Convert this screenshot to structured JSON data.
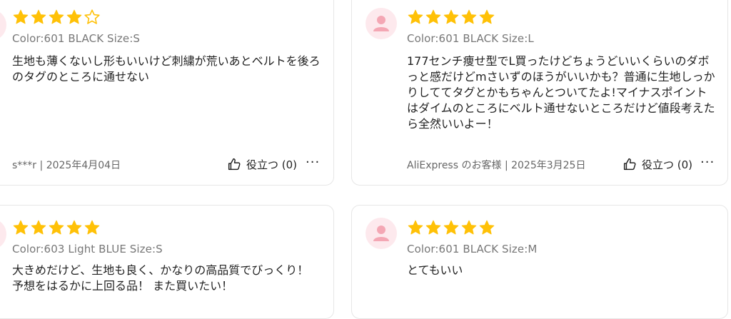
{
  "reviews": [
    {
      "rating": 4,
      "variant": "Color:601 BLACK Size:S",
      "text": "生地も薄くないし形もいいけど刺繍が荒いあとベルトを後ろのタグのところに通せない",
      "reviewer": "s***r",
      "separator": "|",
      "date": "2025年4月04日",
      "helpful_label": "役立つ (0)",
      "more_label": "···"
    },
    {
      "rating": 5,
      "variant": "Color:601 BLACK Size:L",
      "text": "177センチ痩せ型でL買ったけどちょうどいいくらいのダボっと感だけどmさいずのほうがいいかも？普通に生地しっかりしててタグとかもちゃんとついてたよ!マイナスポイントはダイムのところにベルト通せないところだけど値段考えたら全然いいよー！",
      "reviewer": "AliExpress のお客様",
      "separator": "|",
      "date": "2025年3月25日",
      "helpful_label": "役立つ (0)",
      "more_label": "···"
    },
    {
      "rating": 5,
      "variant": "Color:603 Light BLUE Size:S",
      "text": "大きめだけど、生地も良く、かなりの高品質でびっくり！ 予想をはるかに上回る品！ また買いたい！"
    },
    {
      "rating": 5,
      "variant": "Color:601 BLACK Size:M",
      "text": "とてもいい"
    }
  ],
  "colors": {
    "star_filled": "#FFC107",
    "star_empty_outline": "#FFC107",
    "avatar_bg": "#FDE9ED",
    "avatar_icon": "#F4A7B4",
    "card_border": "#E6E6E6"
  },
  "icons": {
    "avatar": "user-silhouette-icon",
    "helpful": "thumbs-up-icon",
    "more": "more-horizontal-icon"
  }
}
